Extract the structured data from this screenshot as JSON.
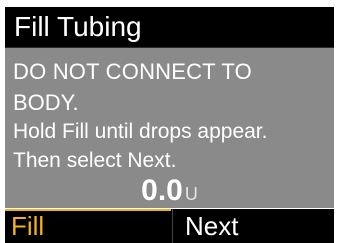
{
  "screen": {
    "title": "Fill Tubing",
    "message": {
      "line1": "DO NOT CONNECT TO",
      "line2": "BODY.",
      "line3": "Hold Fill until drops appear.",
      "line4": "Then select Next."
    },
    "amount": {
      "value": "0.0",
      "unit": "U"
    }
  },
  "softkeys": {
    "left_label": "Fill",
    "right_label": "Next"
  },
  "colors": {
    "title_bar": "#000000",
    "content_bg": "#8a8a8a",
    "active_softkey": "#f2b21b",
    "text": "#ffffff"
  }
}
